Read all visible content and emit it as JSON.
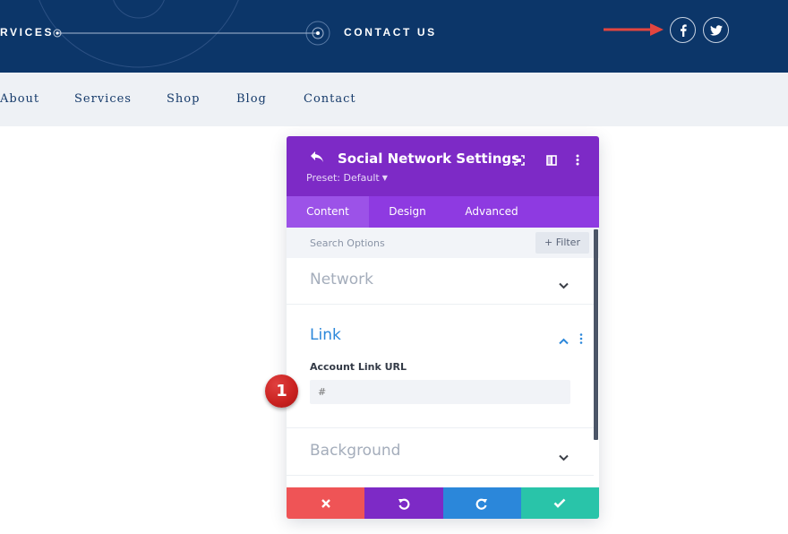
{
  "header": {
    "services_label": "RVICES",
    "contact_label": "CONTACT US",
    "social_icons": [
      "facebook-icon",
      "twitter-icon"
    ],
    "bg_color": "#0c3669"
  },
  "nav": {
    "items": [
      "About",
      "Services",
      "Shop",
      "Blog",
      "Contact"
    ]
  },
  "modal": {
    "title": "Social Network Settings",
    "preset_label": "Preset: Default",
    "tabs": [
      "Content",
      "Design",
      "Advanced"
    ],
    "active_tab": "Content",
    "search_placeholder": "Search Options",
    "filter_label": "Filter",
    "sections": {
      "network": "Network",
      "link": "Link",
      "background": "Background"
    },
    "field": {
      "label": "Account Link URL",
      "placeholder": "#"
    },
    "colors": {
      "header": "#7d2ac6",
      "tabs": "#8e3ae1",
      "cancel": "#ef5456",
      "undo": "#7d2ac6",
      "redo": "#2b87da",
      "save": "#29c4a9"
    }
  },
  "annotations": {
    "step_number": "1"
  }
}
